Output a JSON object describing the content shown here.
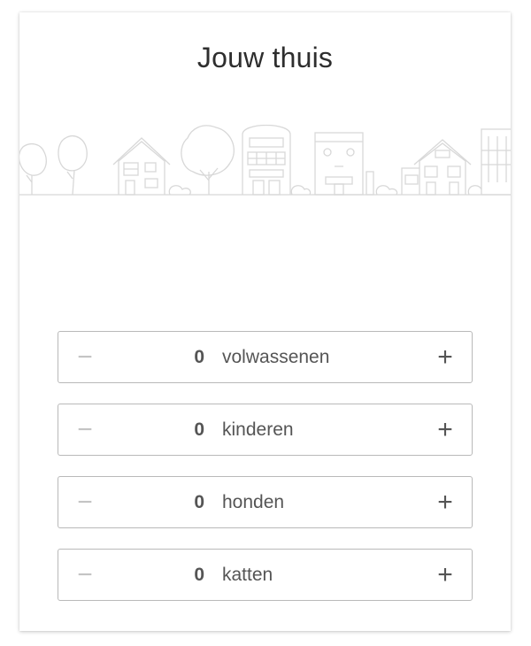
{
  "header": {
    "title": "Jouw thuis"
  },
  "illustration": {
    "name": "street-illustration",
    "line_color": "#d6d6d6"
  },
  "counters": [
    {
      "id": "adults",
      "value": "0",
      "label": "volwassenen",
      "minus": "−",
      "plus": "+"
    },
    {
      "id": "children",
      "value": "0",
      "label": "kinderen",
      "minus": "−",
      "plus": "+"
    },
    {
      "id": "dogs",
      "value": "0",
      "label": "honden",
      "minus": "−",
      "plus": "+"
    },
    {
      "id": "cats",
      "value": "0",
      "label": "katten",
      "minus": "−",
      "plus": "+"
    }
  ],
  "colors": {
    "border": "#b9b9b9",
    "text": "#555555",
    "disabled": "#c4c4c4"
  }
}
